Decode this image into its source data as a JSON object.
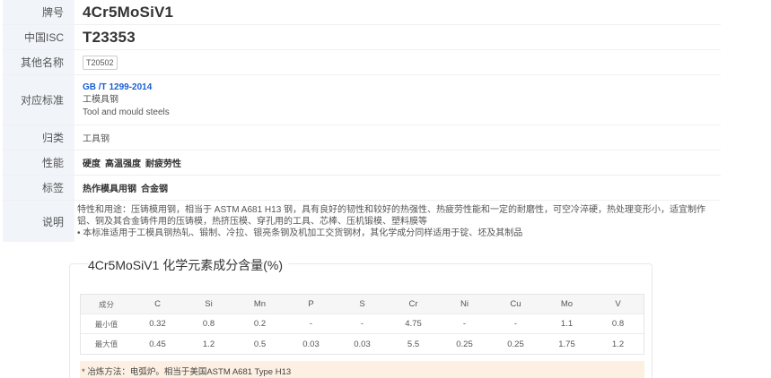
{
  "grade": {
    "label": "牌号",
    "value": "4Cr5MoSiV1"
  },
  "isc": {
    "label": "中国ISC",
    "value": "T23353"
  },
  "other_names": {
    "label": "其他名称",
    "value": "T20502"
  },
  "standard": {
    "label": "对应标准",
    "code": "GB /T 1299-2014",
    "cn_name": "工模具钢",
    "en_name": "Tool and mould steels"
  },
  "category": {
    "label": "归类",
    "value": "工具钢"
  },
  "properties": {
    "label": "性能",
    "items": [
      "硬度",
      "高温强度",
      "耐疲劳性"
    ]
  },
  "tags": {
    "label": "标签",
    "items": [
      "热作模具用钢",
      "合金钢"
    ]
  },
  "description": {
    "label": "说明",
    "line1": "特性和用途：压铸模用钢，相当于 ASTM A681 H13 钢，具有良好的韧性和较好的热强性、热疲劳性能和一定的耐磨性，可空冷淬硬，热处理变形小，适宜制作",
    "line2": "铝、铜及其合金铸件用的压铸模，热挤压模、穿孔用的工具、芯棒、压机锻模、塑料膜等",
    "line3": "• 本标准适用于工模具钢热轧、锻制、冷拉、银亮条钢及机加工交货钢材，其化学成分同样适用于锭、坯及其制品"
  },
  "chemistry": {
    "title": "4Cr5MoSiV1 化学元素成分含量(%)",
    "header": [
      "成分",
      "C",
      "Si",
      "Mn",
      "P",
      "S",
      "Cr",
      "Ni",
      "Cu",
      "Mo",
      "V"
    ],
    "rows": [
      [
        "最小值",
        "0.32",
        "0.8",
        "0.2",
        "-",
        "-",
        "4.75",
        "-",
        "-",
        "1.1",
        "0.8"
      ],
      [
        "最大值",
        "0.45",
        "1.2",
        "0.5",
        "0.03",
        "0.03",
        "5.5",
        "0.25",
        "0.25",
        "1.75",
        "1.2"
      ]
    ],
    "note": "* 冶炼方法：电弧炉。相当于美国ASTM A681 Type H13"
  }
}
